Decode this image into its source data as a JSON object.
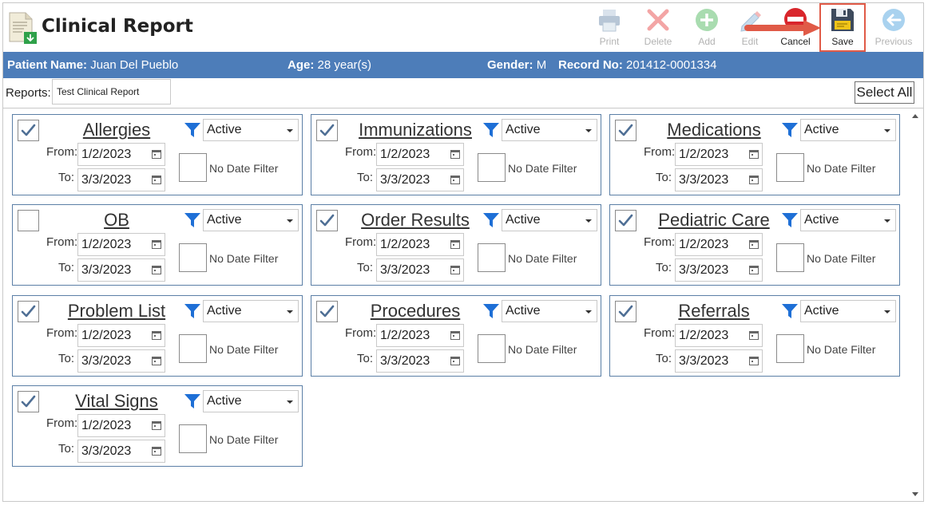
{
  "app": {
    "title": "Clinical Report"
  },
  "toolbar": {
    "buttons": [
      {
        "label": "Print",
        "icon": "printer-icon",
        "enabled": false
      },
      {
        "label": "Delete",
        "icon": "delete-x-icon",
        "enabled": false
      },
      {
        "label": "Add",
        "icon": "add-plus-icon",
        "enabled": false
      },
      {
        "label": "Edit",
        "icon": "pencil-icon",
        "enabled": false
      },
      {
        "label": "Cancel",
        "icon": "cancel-icon",
        "enabled": true
      },
      {
        "label": "Save",
        "icon": "floppy-disk-icon",
        "enabled": true,
        "highlighted": true
      },
      {
        "label": "Previous",
        "icon": "back-arrow-icon",
        "enabled": false
      }
    ]
  },
  "patient": {
    "name_label": "Patient Name:",
    "name": "Juan Del Pueblo",
    "age_label": "Age:",
    "age": "28 year(s)",
    "gender_label": "Gender:",
    "gender": "M",
    "record_label": "Record No:",
    "record": "201412-0001334"
  },
  "reports": {
    "label": "Reports:",
    "value": "Test Clinical Report",
    "select_all": "Select All"
  },
  "common": {
    "from_label": "From:",
    "to_label": "To:",
    "no_date_filter": "No Date Filter"
  },
  "cards": [
    {
      "title": "Allergies",
      "checked": true,
      "status": "Active",
      "from": "1/2/2023",
      "to": "3/3/2023",
      "no_date_filter": false
    },
    {
      "title": "Immunizations",
      "checked": true,
      "status": "Active",
      "from": "1/2/2023",
      "to": "3/3/2023",
      "no_date_filter": false
    },
    {
      "title": "Medications",
      "checked": true,
      "status": "Active",
      "from": "1/2/2023",
      "to": "3/3/2023",
      "no_date_filter": false
    },
    {
      "title": "OB",
      "checked": false,
      "status": "Active",
      "from": "1/2/2023",
      "to": "3/3/2023",
      "no_date_filter": false
    },
    {
      "title": "Order Results",
      "checked": true,
      "status": "Active",
      "from": "1/2/2023",
      "to": "3/3/2023",
      "no_date_filter": false
    },
    {
      "title": "Pediatric Care",
      "checked": true,
      "status": "Active",
      "from": "1/2/2023",
      "to": "3/3/2023",
      "no_date_filter": false
    },
    {
      "title": "Problem List",
      "checked": true,
      "status": "Active",
      "from": "1/2/2023",
      "to": "3/3/2023",
      "no_date_filter": false
    },
    {
      "title": "Procedures",
      "checked": true,
      "status": "Active",
      "from": "1/2/2023",
      "to": "3/3/2023",
      "no_date_filter": false
    },
    {
      "title": "Referrals",
      "checked": true,
      "status": "Active",
      "from": "1/2/2023",
      "to": "3/3/2023",
      "no_date_filter": false
    },
    {
      "title": "Vital Signs",
      "checked": true,
      "status": "Active",
      "from": "1/2/2023",
      "to": "3/3/2023",
      "no_date_filter": false
    }
  ],
  "colors": {
    "patient_bar": "#4d7db9",
    "card_border": "#5b7fa6",
    "highlight": "#e05a47",
    "filter_icon": "#1e6fd6"
  }
}
